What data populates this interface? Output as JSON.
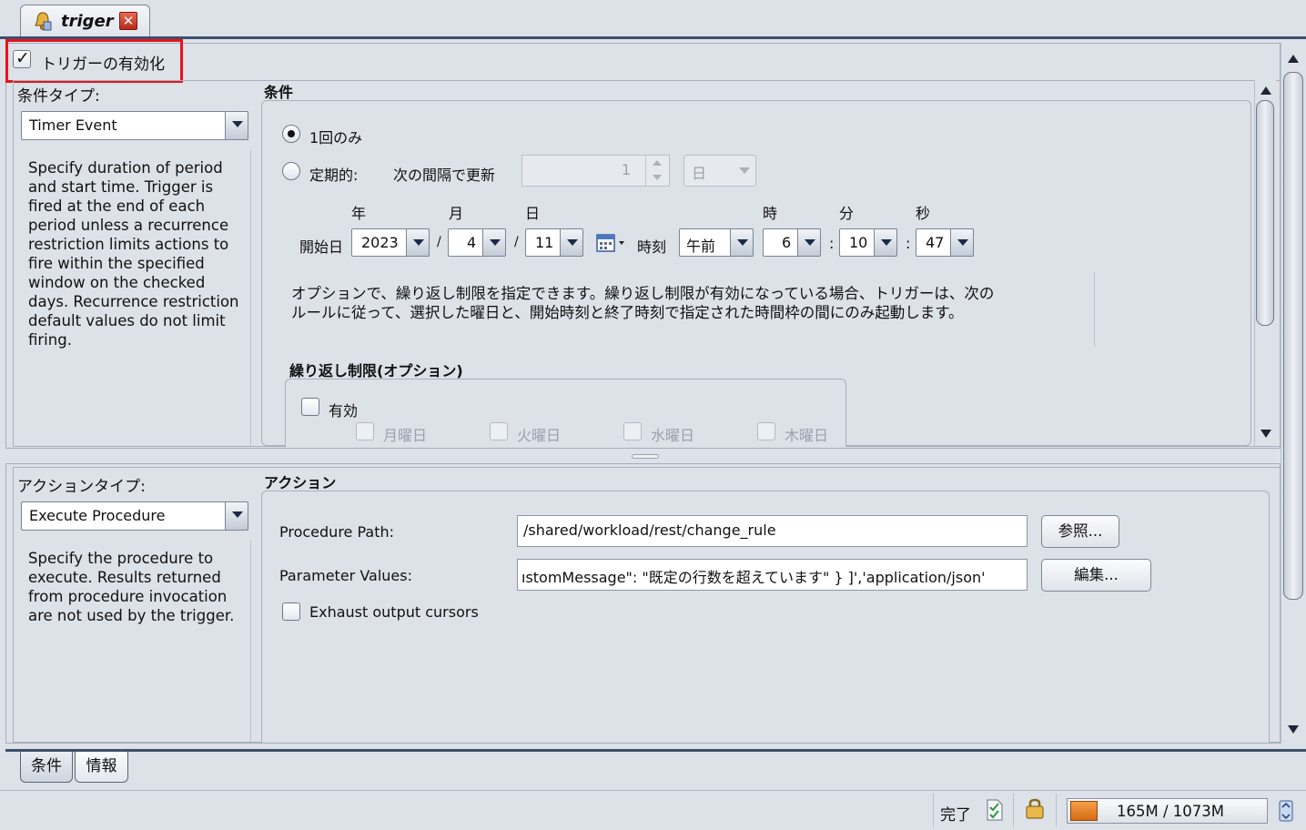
{
  "tab": {
    "title": "triger",
    "close": "✕"
  },
  "trigger": {
    "enable_label": "トリガーの有効化"
  },
  "conditions": {
    "type_label": "条件タイプ:",
    "type_value": "Timer Event",
    "description": "Specify duration of period and start time. Trigger is fired at the end of each period unless a recurrence restriction limits actions to fire within the specified window on the checked days. Recurrence restriction default values do not limit firing.",
    "section_title": "条件",
    "once_label": "1回のみ",
    "periodic_label": "定期的:",
    "interval_label": "次の間隔で更新",
    "interval_value": "1",
    "interval_unit": "日",
    "headers": {
      "year": "年",
      "month": "月",
      "day": "日",
      "hour": "時",
      "minute": "分",
      "second": "秒"
    },
    "start_date_label": "開始日",
    "year": "2023",
    "month": "4",
    "day": "11",
    "date_sep": "/",
    "time_label": "時刻",
    "ampm": "午前",
    "hour": "6",
    "minute": "10",
    "second": "47",
    "time_sep": ":",
    "option_text_1": "オプションで、繰り返し制限を指定できます。繰り返し制限が有効になっている場合、トリガーは、次の",
    "option_text_2": "ルールに従って、選択した曜日と、開始時刻と終了時刻で指定された時間枠の間にのみ起動します。",
    "recurrence_title": "繰り返し制限(オプション)",
    "recurrence_enable": "有効",
    "days": [
      "月曜日",
      "火曜日",
      "水曜日",
      "木曜日"
    ]
  },
  "actions": {
    "type_label": "アクションタイプ:",
    "type_value": "Execute Procedure",
    "description": "Specify the procedure to execute. Results returned from procedure invocation are not used by the trigger.",
    "section_title": "アクション",
    "path_label": "Procedure Path:",
    "path_value": "/shared/workload/rest/change_rule",
    "browse_button": "参照...",
    "params_label": "Parameter Values:",
    "params_value": "ıstomMessage\": \"既定の行数を超えています\"     }  ]','application/json'",
    "edit_button": "編集...",
    "exhaust_label": "Exhaust output cursors"
  },
  "bottom_tabs": [
    "条件",
    "情報"
  ],
  "status": {
    "text": "完了",
    "memory": "165M / 1073M"
  },
  "colors": {
    "highlight": "#e8131b",
    "memory_fill": "#e07a1c"
  }
}
